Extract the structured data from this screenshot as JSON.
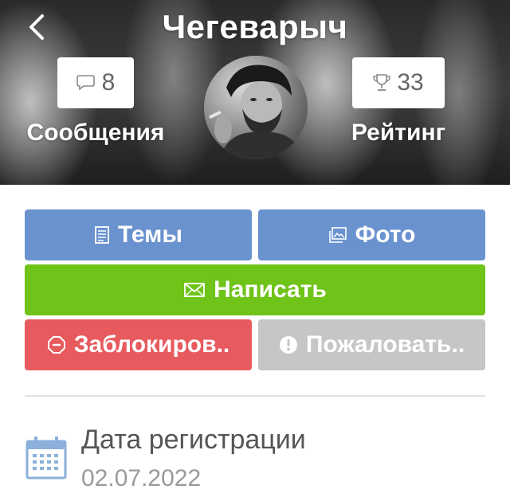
{
  "header": {
    "title": "Чегеварыч",
    "stats": {
      "messages": {
        "count": "8",
        "label": "Сообщения",
        "icon": "chat-bubble-icon"
      },
      "rating": {
        "count": "33",
        "label": "Рейтинг",
        "icon": "trophy-icon"
      }
    }
  },
  "actions": {
    "topics": {
      "label": "Темы",
      "icon": "document-icon"
    },
    "photo": {
      "label": "Фото",
      "icon": "image-icon"
    },
    "write": {
      "label": "Написать",
      "icon": "envelope-icon"
    },
    "block": {
      "label": "Заблокиров..",
      "icon": "octagon-alert-icon"
    },
    "report": {
      "label": "Пожаловать..",
      "icon": "exclamation-circle-icon"
    }
  },
  "registration": {
    "label": "Дата регистрации",
    "date": "02.07.2022",
    "icon": "calendar-icon"
  },
  "colors": {
    "blue": "#6a92cf",
    "green": "#6fc319",
    "red": "#e75a5e",
    "gray": "#c6c6c6",
    "calendar_blue": "#8bb0da"
  }
}
